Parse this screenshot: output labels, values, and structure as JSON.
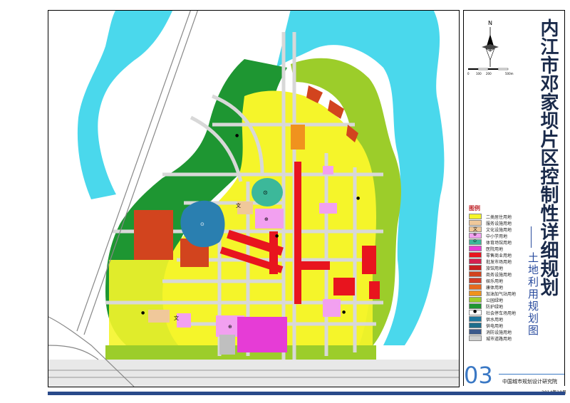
{
  "title": "内江市邓家坝片区控制性详细规划",
  "subtitle": "土地利用规划图",
  "sheet_number": "03",
  "organization": "中国城市规划设计研究院",
  "date": "2014年10月",
  "legend_title": "图例",
  "north_label": "N",
  "scale": {
    "ticks": [
      "0",
      "100",
      "200",
      "",
      "500m"
    ]
  },
  "legend": [
    {
      "label": "二类居住用地",
      "color": "#f5f52a",
      "symbol": ""
    },
    {
      "label": "服务设施用地",
      "color": "#f0c89a",
      "symbol": ""
    },
    {
      "label": "文化设施用地",
      "color": "#f0c89a",
      "symbol": "文"
    },
    {
      "label": "中小学用地",
      "color": "#f2a0f0",
      "symbol": "⊕"
    },
    {
      "label": "体育场馆用地",
      "color": "#3cb89a",
      "symbol": "⊙"
    },
    {
      "label": "医院用地",
      "color": "#e63cd6",
      "symbol": ""
    },
    {
      "label": "零售商业用地",
      "color": "#e8141e",
      "symbol": ""
    },
    {
      "label": "批发市场用地",
      "color": "#d42050",
      "symbol": ""
    },
    {
      "label": "旅馆用地",
      "color": "#c81e1e",
      "symbol": ""
    },
    {
      "label": "商务设施用地",
      "color": "#d2441e",
      "symbol": ""
    },
    {
      "label": "娱乐用地",
      "color": "#d23c28",
      "symbol": ""
    },
    {
      "label": "康体用地",
      "color": "#e6691e",
      "symbol": ""
    },
    {
      "label": "加油加气站用地",
      "color": "#f0921e",
      "symbol": ""
    },
    {
      "label": "公园绿地",
      "color": "#9ccd2a",
      "symbol": ""
    },
    {
      "label": "防护绿地",
      "color": "#1e9632",
      "symbol": ""
    },
    {
      "label": "社会停车场用地",
      "color": "#ffffff",
      "symbol": "●"
    },
    {
      "label": "供水用地",
      "color": "#1e78a0",
      "symbol": ""
    },
    {
      "label": "供电用地",
      "color": "#1e6e8c",
      "symbol": ""
    },
    {
      "label": "消防设施用地",
      "color": "#3c5a8c",
      "symbol": ""
    },
    {
      "label": "城市道路用地",
      "color": "#d0d0d0",
      "symbol": ""
    }
  ],
  "map_labels": {
    "symbol_culture": "文",
    "symbol_school": "⊕",
    "symbol_stadium": "⊙",
    "symbol_parking": "●"
  },
  "colors": {
    "residential": "#f5f52a",
    "park": "#9ccd2a",
    "protective_green": "#1e9632",
    "river": "#4ad8ec",
    "commercial": "#e8141e",
    "school": "#f2a0f0",
    "hospital": "#e63cd6",
    "stadium": "#3cb89a",
    "water_supply": "#2a7fb0",
    "business": "#d2441e",
    "gas": "#f0921e",
    "road": "#d8d8d8"
  }
}
